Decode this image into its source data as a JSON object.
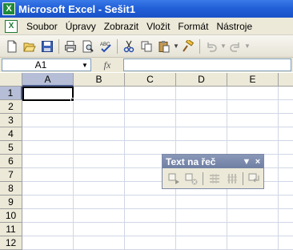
{
  "window": {
    "title": "Microsoft Excel - Sešit1"
  },
  "menu": {
    "items": [
      {
        "label": "Soubor"
      },
      {
        "label": "Úpravy"
      },
      {
        "label": "Zobrazit"
      },
      {
        "label": "Vložit"
      },
      {
        "label": "Formát"
      },
      {
        "label": "Nástroje"
      }
    ]
  },
  "formula_bar": {
    "name_box": "A1",
    "fx": "fx",
    "formula": ""
  },
  "sheet": {
    "columns": [
      "A",
      "B",
      "C",
      "D",
      "E"
    ],
    "rows": [
      "1",
      "2",
      "3",
      "4",
      "5",
      "6",
      "7",
      "8",
      "9",
      "10",
      "11",
      "12"
    ],
    "active_cell": "A1"
  },
  "floating_toolbar": {
    "title": "Text na řeč",
    "minimize": "▼",
    "close": "×"
  },
  "colors": {
    "titlebar": "#2260d8",
    "chrome": "#ece9d8",
    "header_active": "#b5bed6",
    "gridline": "#d0d7e5"
  }
}
